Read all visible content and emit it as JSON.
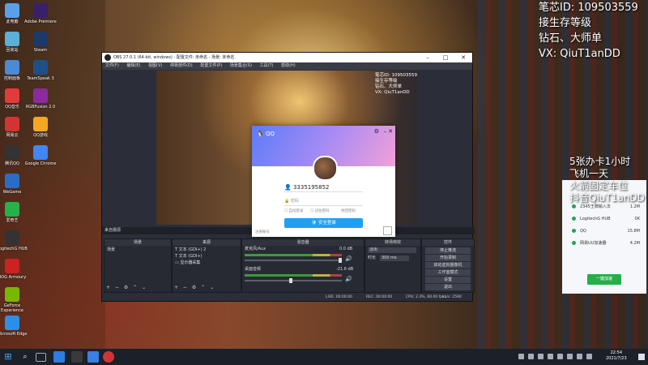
{
  "overlay": {
    "line1": "笔芯ID: 109503559",
    "line2": "接生存等级",
    "line3": "钻石、大师单",
    "line4": "VX: QiuT1anDD",
    "mid1": "5张办卡1小时",
    "mid2": "飞机一天",
    "mid3": "火箭固定车位",
    "mid4": "抖音QiuT1anDD"
  },
  "desktop": {
    "icons": [
      "此电脑",
      "回收站",
      "控制面板",
      "QQ音乐",
      "网易云",
      "腾讯QQ",
      "WeGame",
      "爱奇艺",
      "LogitechG HUB",
      "ROG Armoury",
      "GeForce Experience",
      "Microsoft Edge",
      "Adobe Premiere",
      "Steam",
      "TeamSpeak 3",
      "RGBFusion 2.0",
      "QQ游戏",
      "Google Chrome"
    ]
  },
  "side_panel": {
    "items": [
      {
        "name": "2345王牌输入法",
        "value": "1.2M"
      },
      {
        "name": "LogitechG HUB",
        "value": "0K"
      },
      {
        "name": "QQ",
        "value": "15.8M"
      },
      {
        "name": "网易UU加速器",
        "value": "4.2M"
      }
    ],
    "button": "一键加速"
  },
  "obs": {
    "title": "OBS 27.0.1 (64-bit, windows) - 配置文件: 未命名 - 场景: 未命名",
    "menu": [
      "文件(F)",
      "编辑(E)",
      "视图(V)",
      "停靠部件(D)",
      "配置文件(P)",
      "场景集合(S)",
      "工具(T)",
      "帮助(H)"
    ],
    "preview_overlay": [
      "笔芯ID: 109503559",
      "接生存等级",
      "钻石、大师单",
      "VX: QiuT1anDD"
    ],
    "scene_label": "来自摄源",
    "docks": {
      "scenes": {
        "title": "场景",
        "items": [
          "场景"
        ]
      },
      "sources": {
        "title": "来源",
        "items": [
          "文本 (GDI+) 2",
          "文本 (GDI+)",
          "显示器采集"
        ]
      },
      "mixer": {
        "title": "混音器",
        "channels": [
          {
            "name": "麦克风/Aux",
            "db": "0.0 dB"
          },
          {
            "name": "桌面音频",
            "db": "-21.6 dB"
          }
        ]
      },
      "transitions": {
        "title": "转场特效",
        "type": "淡出",
        "duration_label": "时长",
        "duration": "300 ms"
      },
      "controls": {
        "title": "控件",
        "buttons": [
          "停止推流",
          "开始录制",
          "启动虚拟摄像机",
          "工作室模式",
          "设置",
          "退出"
        ]
      }
    },
    "status": {
      "live": "LIVE: 00:00:00",
      "rec": "REC: 00:00:00",
      "cpu": "CPU: 2.3%, 60.00 fps",
      "kbps": "kb/s: 2590"
    },
    "controls_symbols": "+ − ⚙ ⌃ ⌄"
  },
  "qq_login": {
    "title": "QQ",
    "account": "3335195852",
    "password_placeholder": "密码",
    "opt_auto": "自动登录",
    "opt_remember": "记住密码",
    "opt_forget": "找回密码",
    "login_button": "安全登录",
    "register": "注册账号"
  },
  "taskbar": {
    "time": "22:54",
    "date": "2021/7/23"
  }
}
